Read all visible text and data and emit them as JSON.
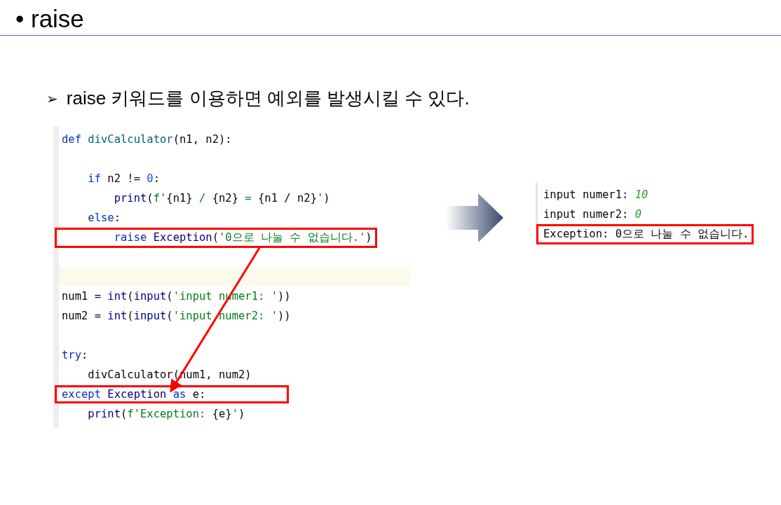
{
  "slide": {
    "title": "• raise",
    "bullet_marker": "➢",
    "bullet": "raise 키워드를 이용하면 예외를 발생시킬 수 있다."
  },
  "code": {
    "lines": [
      {
        "boxed": false,
        "current": false,
        "tokens": [
          {
            "kind": "kw",
            "text": "def"
          },
          {
            "kind": "def",
            "text": " divCalculator"
          },
          {
            "kind": "plain",
            "text": "(n1, n2):"
          }
        ]
      },
      {
        "current": false
      },
      {
        "boxed": false,
        "current": false,
        "tokens": [
          {
            "kind": "kw",
            "text": "    if"
          },
          {
            "kind": "plain",
            "text": " n2 != "
          },
          {
            "kind": "num",
            "text": "0"
          },
          {
            "kind": "plain",
            "text": ":"
          }
        ]
      },
      {
        "boxed": false,
        "current": false,
        "tokens": [
          {
            "kind": "builtin",
            "text": "        print"
          },
          {
            "kind": "plain",
            "text": "("
          },
          {
            "kind": "str",
            "text": "f'"
          },
          {
            "kind": "plain",
            "text": "{n1}"
          },
          {
            "kind": "str",
            "text": " / "
          },
          {
            "kind": "plain",
            "text": "{n2}"
          },
          {
            "kind": "str",
            "text": " = "
          },
          {
            "kind": "plain",
            "text": "{n1 / n2}"
          },
          {
            "kind": "str",
            "text": "'"
          },
          {
            "kind": "plain",
            "text": ")"
          }
        ]
      },
      {
        "boxed": false,
        "current": false,
        "tokens": [
          {
            "kind": "kw",
            "text": "    else"
          },
          {
            "kind": "plain",
            "text": ":"
          }
        ]
      },
      {
        "boxed": true,
        "current": false,
        "tokens": [
          {
            "kind": "kw",
            "text": "        raise"
          },
          {
            "kind": "builtin",
            "text": " Exception"
          },
          {
            "kind": "plain",
            "text": "("
          },
          {
            "kind": "str",
            "text": "'0으로 나눌 수 없습니다.'"
          },
          {
            "kind": "plain",
            "text": ")"
          }
        ]
      },
      {
        "current": false
      },
      {
        "current": true
      },
      {
        "boxed": false,
        "current": false,
        "tokens": [
          {
            "kind": "plain",
            "text": "num1 = "
          },
          {
            "kind": "builtin",
            "text": "int"
          },
          {
            "kind": "plain",
            "text": "("
          },
          {
            "kind": "builtin",
            "text": "input"
          },
          {
            "kind": "plain",
            "text": "("
          },
          {
            "kind": "str",
            "text": "'input numer1: '"
          },
          {
            "kind": "plain",
            "text": "))"
          }
        ]
      },
      {
        "boxed": false,
        "current": false,
        "tokens": [
          {
            "kind": "plain",
            "text": "num2 = "
          },
          {
            "kind": "builtin",
            "text": "int"
          },
          {
            "kind": "plain",
            "text": "("
          },
          {
            "kind": "builtin",
            "text": "input"
          },
          {
            "kind": "plain",
            "text": "("
          },
          {
            "kind": "str",
            "text": "'input numer2: '"
          },
          {
            "kind": "plain",
            "text": "))"
          }
        ]
      },
      {
        "current": false
      },
      {
        "boxed": false,
        "current": false,
        "tokens": [
          {
            "kind": "kw",
            "text": "try"
          },
          {
            "kind": "plain",
            "text": ":"
          }
        ]
      },
      {
        "boxed": false,
        "current": false,
        "tokens": [
          {
            "kind": "plain",
            "text": "    divCalculator(num1, num2)"
          }
        ]
      },
      {
        "boxed": true,
        "current": false,
        "tokens": [
          {
            "kind": "kw",
            "text": "except"
          },
          {
            "kind": "builtin",
            "text": " Exception"
          },
          {
            "kind": "kw",
            "text": " as"
          },
          {
            "kind": "plain",
            "text": " e:            "
          }
        ]
      },
      {
        "boxed": false,
        "current": false,
        "tokens": [
          {
            "kind": "builtin",
            "text": "    print"
          },
          {
            "kind": "plain",
            "text": "("
          },
          {
            "kind": "str",
            "text": "f'Exception: "
          },
          {
            "kind": "plain",
            "text": "{e}"
          },
          {
            "kind": "str",
            "text": "'"
          },
          {
            "kind": "plain",
            "text": ")"
          }
        ]
      }
    ]
  },
  "output": {
    "lines": [
      {
        "boxed": false,
        "tokens": [
          {
            "kind": "plain",
            "text": "input numer1: "
          },
          {
            "kind": "input",
            "text": "10"
          }
        ]
      },
      {
        "boxed": false,
        "tokens": [
          {
            "kind": "plain",
            "text": "input numer2: "
          },
          {
            "kind": "input",
            "text": "0"
          }
        ]
      },
      {
        "boxed": true,
        "tokens": [
          {
            "kind": "plain",
            "text": "Exception: 0으로 나눌 수 없습니다."
          }
        ]
      }
    ]
  }
}
